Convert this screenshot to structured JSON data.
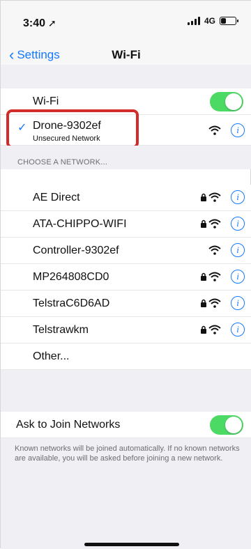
{
  "status": {
    "time": "3:40",
    "network": "4G"
  },
  "nav": {
    "back_label": "Settings",
    "title": "Wi-Fi"
  },
  "wifi_toggle": {
    "label": "Wi-Fi",
    "enabled": true
  },
  "connected": {
    "name": "Drone-9302ef",
    "subtitle": "Unsecured Network"
  },
  "choose_header": "CHOOSE A NETWORK...",
  "networks": [
    {
      "name": "AE Direct",
      "secured": true
    },
    {
      "name": "ATA-CHIPPO-WIFI",
      "secured": true
    },
    {
      "name": "Controller-9302ef",
      "secured": false
    },
    {
      "name": "MP264808CD0",
      "secured": true
    },
    {
      "name": "TelstraC6D6AD",
      "secured": true
    },
    {
      "name": "Telstrawkm",
      "secured": true
    }
  ],
  "other_label": "Other...",
  "ask_join": {
    "label": "Ask to Join Networks",
    "enabled": true,
    "footer": "Known networks will be joined automatically. If no known networks are available, you will be asked before joining a new network."
  },
  "colors": {
    "accent": "#1479ff",
    "toggle_on": "#4cd964",
    "highlight": "#d22b2b"
  },
  "icons": [
    "location-arrow-icon",
    "cellular-signal-icon",
    "battery-icon",
    "chevron-left-icon",
    "checkmark-icon",
    "wifi-icon",
    "lock-icon",
    "info-icon"
  ]
}
